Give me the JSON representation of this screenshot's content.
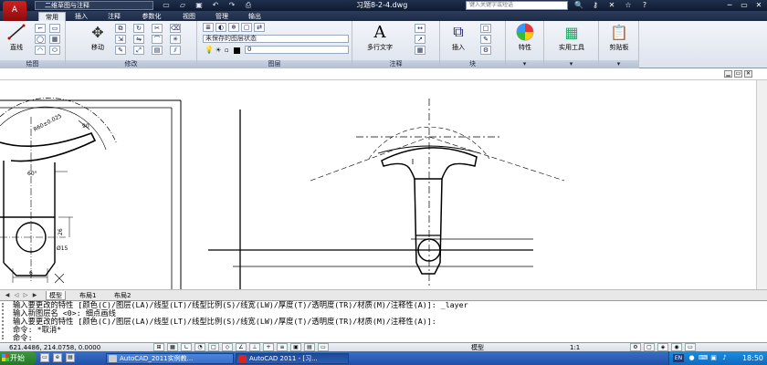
{
  "titlebar": {
    "logo": "A",
    "workspace": "二维草图与注释",
    "qat_icons": [
      "new-icon",
      "open-icon",
      "save-icon",
      "undo-icon",
      "redo-icon",
      "print-icon"
    ],
    "qat_glyphs": [
      "▭",
      "▱",
      "▣",
      "↶",
      "↷",
      "⎙"
    ],
    "doc_title": "习题8-2-4.dwg",
    "help_placeholder": "键入关键字或短语",
    "title_icon_glyphs": [
      "🔍",
      "⚷",
      "✕",
      "☆",
      "?"
    ],
    "window_controls": [
      "─",
      "▭",
      "✕"
    ]
  },
  "ribbon_tabs": [
    "常用",
    "插入",
    "注释",
    "参数化",
    "视图",
    "管理",
    "输出"
  ],
  "ribbon": {
    "draw": {
      "title": "绘图",
      "line_label": "直线"
    },
    "modify": {
      "title": "修改",
      "move_label": "移动"
    },
    "layers": {
      "title": "图层",
      "layer_state": "未保存的图层状态",
      "current_layer": "0"
    },
    "annotation": {
      "title": "注释",
      "mtext_label": "多行文字",
      "mtext_glyph": "A"
    },
    "block": {
      "title": "块",
      "insert_label": "插入"
    },
    "properties": {
      "label": "特性"
    },
    "utilities": {
      "label": "实用工具"
    },
    "clipboard": {
      "label": "剪贴板"
    }
  },
  "layout_tabs": [
    "模型",
    "布局1",
    "布局2"
  ],
  "command": {
    "lines": [
      "输入要更改的特性 [颜色(C)/图层(LA)/线型(LT)/线型比例(S)/线宽(LW)/厚度(T)/透明度(TR)/材质(M)/注释性(A)]: _layer",
      "输入新图层名 <0>: 细点画线",
      "输入要更改的特性 [颜色(C)/图层(LA)/线型(LT)/线型比例(S)/线宽(LW)/厚度(T)/透明度(TR)/材质(M)/注释性(A)]:",
      "命令: *取消*",
      "命令:"
    ]
  },
  "status": {
    "coords": "621.4486, 214.0758, 0.0000",
    "model": "模型",
    "scale": "1:1"
  },
  "taskbar": {
    "start": "开始",
    "tasks": [
      "AutoCAD_2011实例教...",
      "AutoCAD 2011 - [习..."
    ],
    "lang": "EN",
    "clock": "18:50"
  },
  "drawing": {
    "dim_r60": "R60±0.025",
    "dim_60deg": "60°",
    "dim_26": "26",
    "dim_d15": "Ø15",
    "dim_6": "6",
    "dim_90": "90"
  }
}
